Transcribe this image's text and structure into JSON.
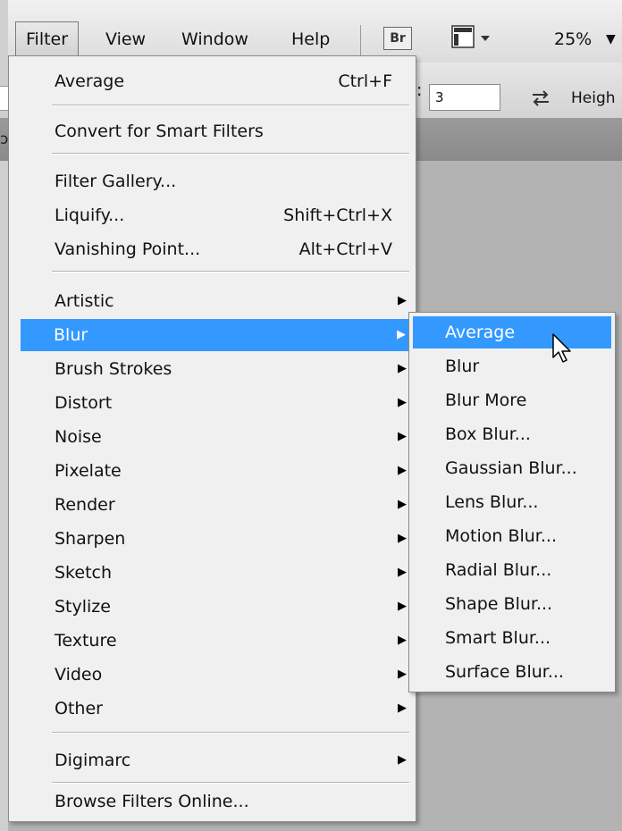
{
  "menubar": {
    "filter": "Filter",
    "view": "View",
    "window": "Window",
    "help": "Help",
    "bridge_button": "Br",
    "zoom": "25%"
  },
  "options_bar": {
    "field_value": "3",
    "height_label": "Heigh"
  },
  "filter_menu": {
    "items": [
      {
        "label": "Average",
        "shortcut": "Ctrl+F"
      },
      {
        "label": "Convert for Smart Filters"
      },
      {
        "label": "Filter Gallery..."
      },
      {
        "label": "Liquify...",
        "shortcut": "Shift+Ctrl+X"
      },
      {
        "label": "Vanishing Point...",
        "shortcut": "Alt+Ctrl+V"
      },
      {
        "label": "Artistic"
      },
      {
        "label": "Blur"
      },
      {
        "label": "Brush Strokes"
      },
      {
        "label": "Distort"
      },
      {
        "label": "Noise"
      },
      {
        "label": "Pixelate"
      },
      {
        "label": "Render"
      },
      {
        "label": "Sharpen"
      },
      {
        "label": "Sketch"
      },
      {
        "label": "Stylize"
      },
      {
        "label": "Texture"
      },
      {
        "label": "Video"
      },
      {
        "label": "Other"
      },
      {
        "label": "Digimarc"
      },
      {
        "label": "Browse Filters Online..."
      }
    ]
  },
  "blur_submenu": {
    "items": [
      {
        "label": "Average"
      },
      {
        "label": "Blur"
      },
      {
        "label": "Blur More"
      },
      {
        "label": "Box Blur..."
      },
      {
        "label": "Gaussian Blur..."
      },
      {
        "label": "Lens Blur..."
      },
      {
        "label": "Motion Blur..."
      },
      {
        "label": "Radial Blur..."
      },
      {
        "label": "Shape Blur..."
      },
      {
        "label": "Smart Blur..."
      },
      {
        "label": "Surface Blur..."
      }
    ]
  },
  "colors": {
    "highlight": "#3399ff",
    "menu_bg": "#f0f0f0",
    "canvas_bg": "#b3b3b3"
  }
}
